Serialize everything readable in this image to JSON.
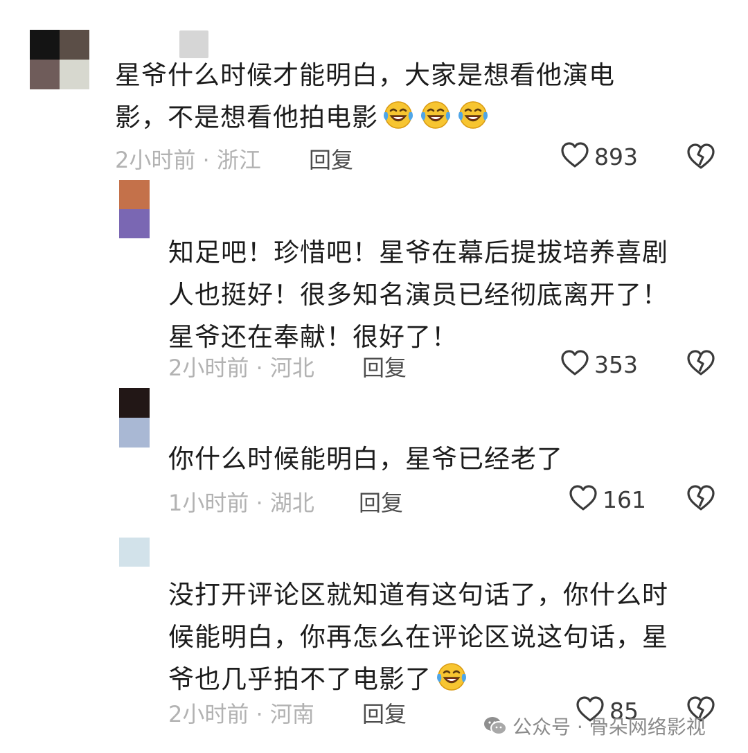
{
  "comments": [
    {
      "lines": [
        "星爷什么时候才能明白，大家是想看他演电",
        "影，不是想看他拍电影"
      ],
      "emoji_count": 3,
      "meta": "2小时前 · 浙江",
      "reply_label": "回复",
      "likes": "893"
    },
    {
      "lines": [
        "知足吧！珍惜吧！星爷在幕后提拔培养喜剧",
        "人也挺好！很多知名演员已经彻底离开了！",
        "星爷还在奉献！很好了！"
      ],
      "meta": "2小时前 · 河北",
      "reply_label": "回复",
      "likes": "353"
    },
    {
      "lines": [
        "你什么时候能明白，星爷已经老了"
      ],
      "meta": "1小时前 · 湖北",
      "reply_label": "回复",
      "likes": "161"
    },
    {
      "lines": [
        "没打开评论区就知道有这句话了，你什么时",
        "候能明白，你再怎么在评论区说这句话，星",
        "爷也几乎拍不了电影了"
      ],
      "emoji_count": 1,
      "meta": "2小时前 · 河南",
      "reply_label": "回复",
      "likes": "85"
    }
  ],
  "icons": {
    "like": "heart-outline-icon",
    "dislike": "broken-heart-icon",
    "emoji": "laughing-crying-emoji",
    "watermark": "wechat-icon"
  },
  "watermark": {
    "text": "公众号 · 骨朵网络影视"
  },
  "colors": {
    "text": "#1c1c1c",
    "meta": "#b2b2b2",
    "reply": "#4d4d4d",
    "icon": "#3a3a3a",
    "emoji_face": "#f7c531"
  }
}
